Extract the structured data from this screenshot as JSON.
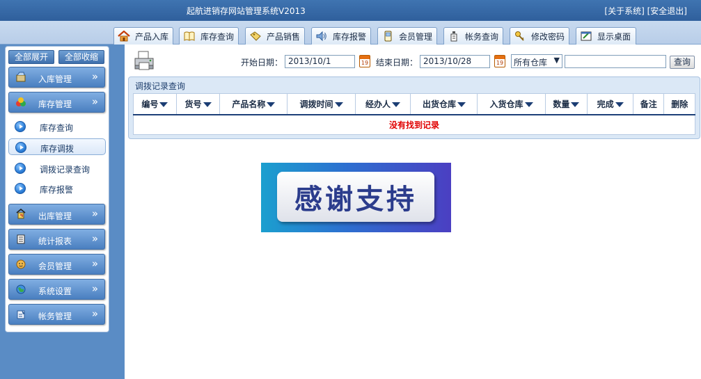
{
  "header": {
    "title": "起航进销存网站管理系统V2013",
    "about": "[关于系统]",
    "logout": "[安全退出]"
  },
  "tabs": [
    {
      "label": "产品入库",
      "icon": "house-icon"
    },
    {
      "label": "库存查询",
      "icon": "book-icon"
    },
    {
      "label": "产品销售",
      "icon": "tag-icon"
    },
    {
      "label": "库存报警",
      "icon": "speaker-icon"
    },
    {
      "label": "会员管理",
      "icon": "phone-icon"
    },
    {
      "label": "帐务查询",
      "icon": "bottle-icon"
    },
    {
      "label": "修改密码",
      "icon": "keys-icon"
    },
    {
      "label": "显示桌面",
      "icon": "desktop-icon"
    }
  ],
  "sidebar": {
    "expand_all": "全部展开",
    "collapse_all": "全部收缩",
    "menus": [
      {
        "label": "入库管理",
        "icon": "inbox-icon"
      },
      {
        "label": "库存管理",
        "icon": "boxes-icon"
      },
      {
        "label": "出库管理",
        "icon": "truck-icon"
      },
      {
        "label": "统计报表",
        "icon": "report-icon"
      },
      {
        "label": "会员管理",
        "icon": "member-icon"
      },
      {
        "label": "系统设置",
        "icon": "globe-icon"
      },
      {
        "label": "帐务管理",
        "icon": "ledger-icon"
      }
    ],
    "subitems": [
      {
        "label": "库存查询"
      },
      {
        "label": "库存调拨"
      },
      {
        "label": "调拨记录查询"
      },
      {
        "label": "库存报警"
      }
    ]
  },
  "query": {
    "start_label": "开始日期：",
    "start_value": "2013/10/1",
    "end_label": "结束日期：",
    "end_value": "2013/10/28",
    "calendar_day": "19",
    "warehouse_selected": "所有仓库",
    "keyword_value": "",
    "button": "查询"
  },
  "records": {
    "title": "调拨记录查询",
    "columns": [
      "编号",
      "货号",
      "产品名称",
      "调拨时间",
      "经办人",
      "出货仓库",
      "入货仓库",
      "数量",
      "完成",
      "备注",
      "删除"
    ],
    "empty_message": "没有找到记录"
  },
  "banner": {
    "text": "感谢支持"
  }
}
